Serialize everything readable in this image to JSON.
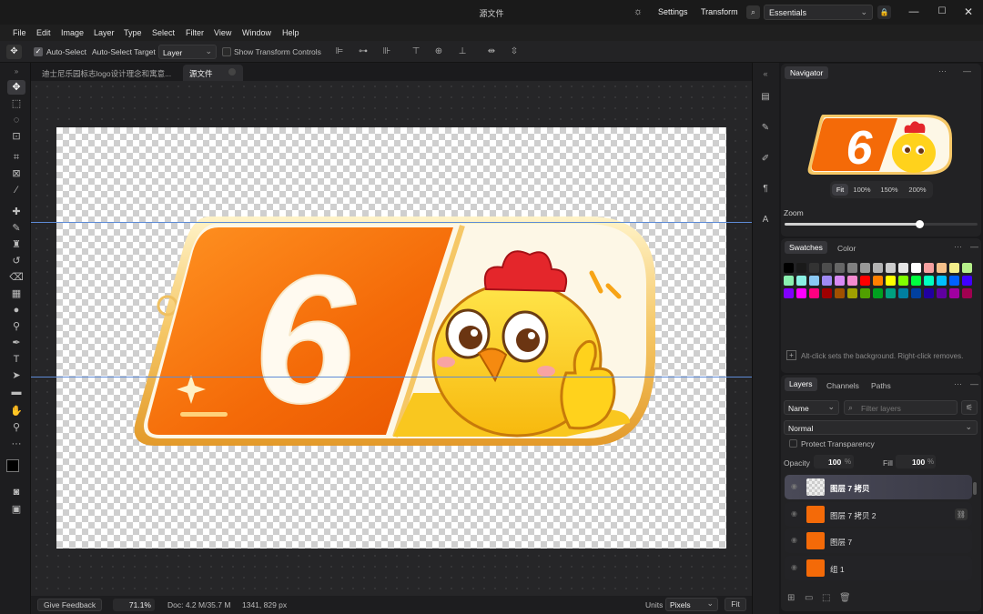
{
  "window": {
    "title": "源文件",
    "settings_label": "Settings",
    "transform_label": "Transform",
    "workspace": "Essentials",
    "icons": [
      "sun-icon",
      "search-icon",
      "lock-icon",
      "minimize-icon",
      "maximize-icon",
      "close-icon"
    ]
  },
  "menu": [
    "File",
    "Edit",
    "Image",
    "Layer",
    "Type",
    "Select",
    "Filter",
    "View",
    "Window",
    "Help"
  ],
  "options": {
    "auto_select_label": "Auto-Select",
    "auto_select_target_label": "Auto-Select Target",
    "target_value": "Layer",
    "show_transform_label": "Show Transform Controls"
  },
  "tabs": [
    {
      "label": "迪士尼乐园标志logo设计理念和寓意..."
    },
    {
      "label": "源文件"
    }
  ],
  "canvas": {
    "badge_number": "6"
  },
  "status": {
    "feedback_label": "Give Feedback",
    "zoom": "71.1%",
    "doc": "Doc: 4.2 M/35.7 M",
    "dimensions": "1341, 829 px",
    "units_label": "Units",
    "units_value": "Pixels",
    "fit_label": "Fit"
  },
  "navigator": {
    "tab": "Navigator",
    "zoom_buttons": [
      "Fit",
      "100%",
      "150%",
      "200%"
    ],
    "zoom_label": "Zoom",
    "zoom_value": 0.7
  },
  "swatches": {
    "tabs": [
      "Swatches",
      "Color"
    ],
    "hint": "Alt-click sets the background. Right-click removes.",
    "rows": [
      [
        "#000000",
        "#1a1a1a",
        "#333333",
        "#4d4d4d",
        "#666666",
        "#808080",
        "#999999",
        "#b3b3b3",
        "#cccccc",
        "#e6e6e6",
        "#ffffff",
        "#f4a0a0",
        "#f4c08a",
        "#f4ee8a",
        "#b6f08a"
      ],
      [
        "#8af0b0",
        "#8af0e4",
        "#8ac8f4",
        "#a08af4",
        "#d88af4",
        "#f48ad0",
        "#ff0000",
        "#ff8000",
        "#ffff00",
        "#80ff00",
        "#00ff40",
        "#00ffc0",
        "#00c0ff",
        "#0060ff",
        "#4000ff"
      ],
      [
        "#8000ff",
        "#ff00ff",
        "#ff0080",
        "#a00000",
        "#a05000",
        "#a0a000",
        "#50a000",
        "#00a020",
        "#00a080",
        "#0080a0",
        "#0040a0",
        "#2000a0",
        "#6000a0",
        "#a000a0",
        "#a00050"
      ]
    ]
  },
  "layers": {
    "tabs": [
      "Layers",
      "Channels",
      "Paths"
    ],
    "filter_kind": "Name",
    "filter_placeholder": "Filter layers",
    "blend_mode": "Normal",
    "protect_label": "Protect Transparency",
    "opacity_label": "Opacity",
    "opacity_value": "100",
    "fill_label": "Fill",
    "fill_value": "100",
    "percent": "%",
    "items": [
      {
        "name": "图层 7 拷贝"
      },
      {
        "name": "图层 7 拷贝 2"
      },
      {
        "name": "图层 7"
      },
      {
        "name": "组 1"
      }
    ]
  }
}
